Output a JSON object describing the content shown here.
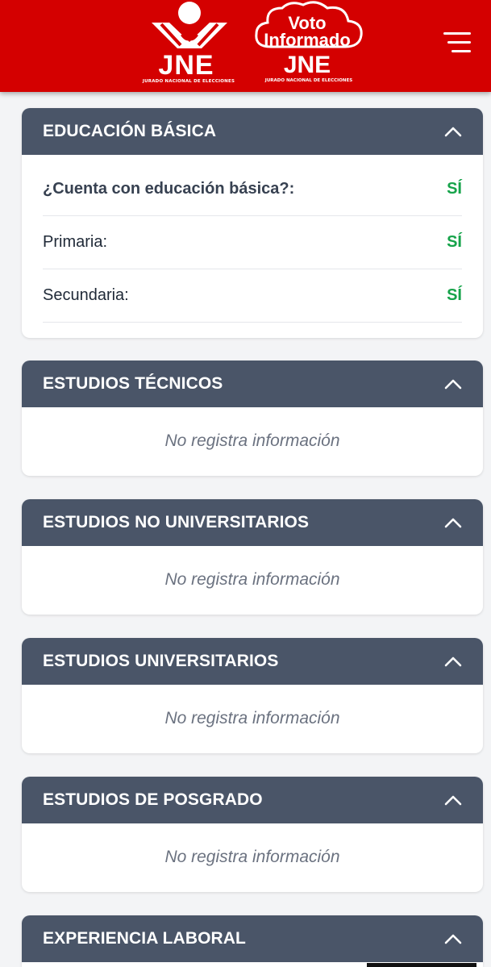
{
  "header": {
    "jne_logo_text": "JNE",
    "jne_logo_subtitle": "JURADO NACIONAL DE ELECCIONES",
    "voto_line1": "Voto",
    "voto_line2": "Informado",
    "voto_jne": "JNE",
    "voto_subtitle": "JURADO NACIONAL DE ELECCIONES",
    "menu_icon": "hamburger-menu-icon",
    "brand_color": "#d40000"
  },
  "sections": [
    {
      "title": "EDUCACIÓN BÁSICA",
      "rows": [
        {
          "label": "¿Cuenta con educación básica?:",
          "value": "SÍ"
        },
        {
          "label": "Primaria:",
          "value": "SÍ"
        },
        {
          "label": "Secundaria:",
          "value": "SÍ"
        }
      ]
    },
    {
      "title": "ESTUDIOS TÉCNICOS",
      "empty": "No registra información"
    },
    {
      "title": "ESTUDIOS NO UNIVERSITARIOS",
      "empty": "No registra información"
    },
    {
      "title": "ESTUDIOS UNIVERSITARIOS",
      "empty": "No registra información"
    },
    {
      "title": "ESTUDIOS DE POSGRADO",
      "empty": "No registra información"
    },
    {
      "title": "EXPERIENCIA LABORAL"
    }
  ],
  "colors": {
    "card_header": "#4a5568",
    "value_green": "#16a34a",
    "page_bg": "#f3f4f6"
  },
  "icons": {
    "collapse": "chevron-up-icon"
  }
}
